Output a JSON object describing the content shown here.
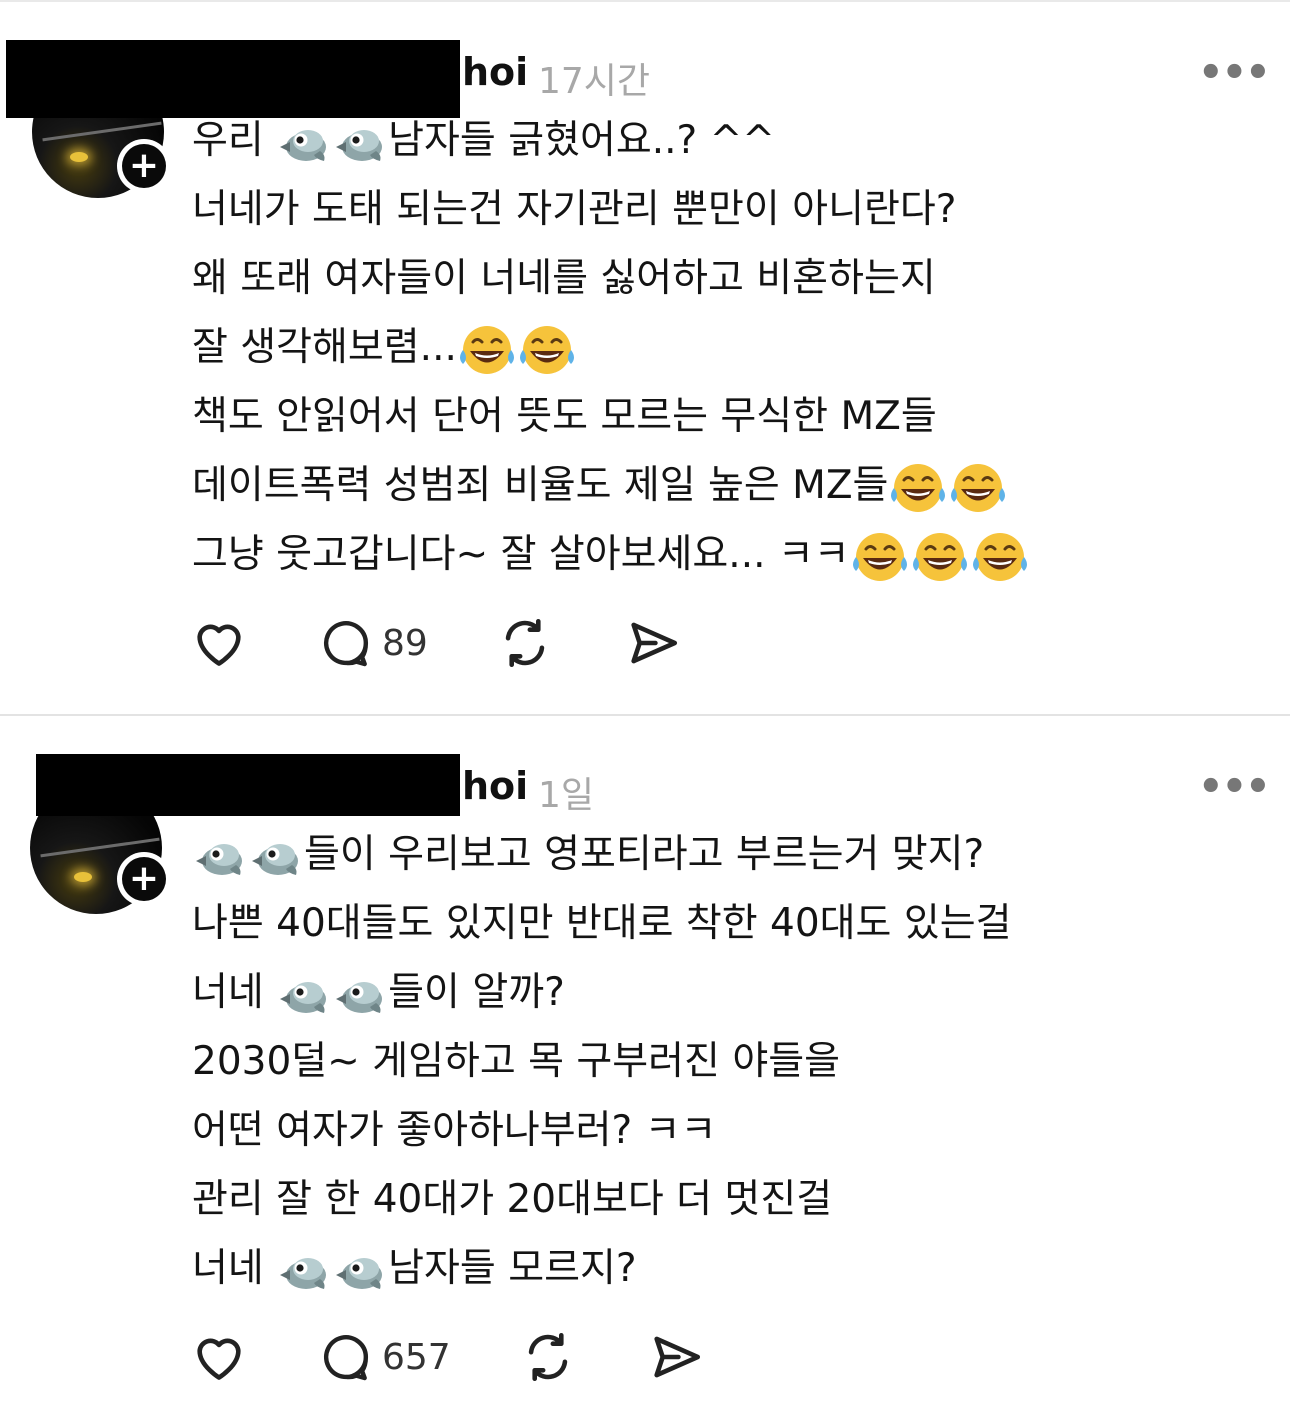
{
  "posts": [
    {
      "username": "hoi",
      "time": "17시간",
      "lines": [
        "우리 [bird][bird]남자들 긁혔어요..? ^^",
        "너네가 도태 되는건 자기관리 뿐만이 아니란다?",
        "왜 또래 여자들이 너네를 싫어하고 비혼하는지",
        "잘 생각해보렴...[laugh][laugh]",
        "책도 안읽어서 단어 뜻도 모르는 무식한 MZ들",
        "데이트폭력 성범죄 비율도 제일 높은 MZ들[laugh][laugh]",
        "그냥 웃고갑니다~ 잘 살아보세요... ㅋㅋ[laugh][laugh][laugh]"
      ],
      "reply_count": "89"
    },
    {
      "username": "hoi",
      "time": "1일",
      "lines": [
        "[bird][bird]들이 우리보고 영포티라고 부르는거 맞지?",
        "나쁜 40대들도 있지만 반대로 착한 40대도 있는걸",
        "너네 [bird][bird]들이 알까?",
        "2030덜~ 게임하고 목 구부러진 야들을",
        "어떤 여자가 좋아하나부러? ㅋㅋ",
        "관리 잘 한 40대가 20대보다 더 멋진걸",
        "너네 [bird][bird]남자들 모르지?"
      ],
      "reply_count": "657"
    }
  ],
  "icons": {
    "more": "more-horizontal-icon",
    "like": "heart-icon",
    "reply": "comment-bubble-icon",
    "repost": "repost-icon",
    "share": "send-icon",
    "emoji_bird": "bird-emoji",
    "emoji_laugh": "tears-of-joy-emoji"
  },
  "colors": {
    "text": "#141414",
    "meta": "#a8a8a8",
    "redaction": "#000000"
  }
}
